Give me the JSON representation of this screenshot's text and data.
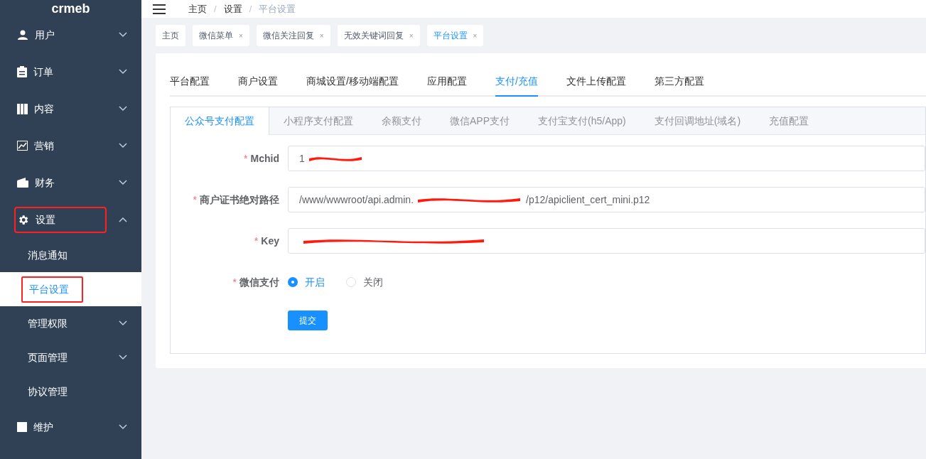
{
  "logo": "crmeb",
  "breadcrumb": [
    "主页",
    "设置",
    "平台设置"
  ],
  "breadcrumb_separator": "/",
  "sidebar": {
    "items": [
      {
        "label": "用户",
        "expanded": false,
        "selected": false
      },
      {
        "label": "订单",
        "expanded": false,
        "selected": false
      },
      {
        "label": "内容",
        "expanded": false,
        "selected": false
      },
      {
        "label": "营销",
        "expanded": false,
        "selected": false
      },
      {
        "label": "财务",
        "expanded": false,
        "selected": false
      },
      {
        "label": "设置",
        "expanded": true,
        "selected": true,
        "children": [
          {
            "label": "消息通知",
            "selected": false,
            "has_children": false
          },
          {
            "label": "平台设置",
            "selected": true,
            "has_children": false
          },
          {
            "label": "管理权限",
            "selected": false,
            "has_children": true
          },
          {
            "label": "页面管理",
            "selected": false,
            "has_children": true
          },
          {
            "label": "协议管理",
            "selected": false,
            "has_children": false
          }
        ]
      },
      {
        "label": "维护",
        "expanded": false,
        "selected": false
      }
    ]
  },
  "open_tabs": [
    {
      "label": "主页",
      "closable": false,
      "selected": false
    },
    {
      "label": "微信菜单",
      "closable": true,
      "selected": false
    },
    {
      "label": "微信关注回复",
      "closable": true,
      "selected": false
    },
    {
      "label": "无效关键词回复",
      "closable": true,
      "selected": false
    },
    {
      "label": "平台设置",
      "closable": true,
      "selected": true
    }
  ],
  "close_glyph": "×",
  "tabs": [
    {
      "label": "平台配置",
      "selected": false
    },
    {
      "label": "商户设置",
      "selected": false
    },
    {
      "label": "商城设置/移动端配置",
      "selected": false
    },
    {
      "label": "应用配置",
      "selected": false
    },
    {
      "label": "支付/充值",
      "selected": true
    },
    {
      "label": "文件上传配置",
      "selected": false
    },
    {
      "label": "第三方配置",
      "selected": false
    }
  ],
  "subtabs": [
    {
      "label": "公众号支付配置",
      "selected": true
    },
    {
      "label": "小程序支付配置",
      "selected": false
    },
    {
      "label": "余额支付",
      "selected": false
    },
    {
      "label": "微信APP支付",
      "selected": false
    },
    {
      "label": "支付宝支付(h5/App)",
      "selected": false
    },
    {
      "label": "支付回调地址(域名)",
      "selected": false
    },
    {
      "label": "充值配置",
      "selected": false
    }
  ],
  "form": {
    "required_mark": "*",
    "fields": [
      {
        "kind": "input",
        "label": "Mchid",
        "value": "1",
        "redacted": true
      },
      {
        "kind": "input",
        "label": "商户证书绝对路径",
        "value": "/www/wwwroot/api.admin.",
        "suffix": "/p12/apiclient_cert_mini.p12",
        "redacted": true
      },
      {
        "kind": "input",
        "label": "Key",
        "redacted": true
      },
      {
        "kind": "radio",
        "label": "微信支付",
        "options": [
          {
            "label": "开启",
            "selected": true
          },
          {
            "label": "关闭",
            "selected": false
          }
        ]
      }
    ],
    "submit": "提交"
  }
}
